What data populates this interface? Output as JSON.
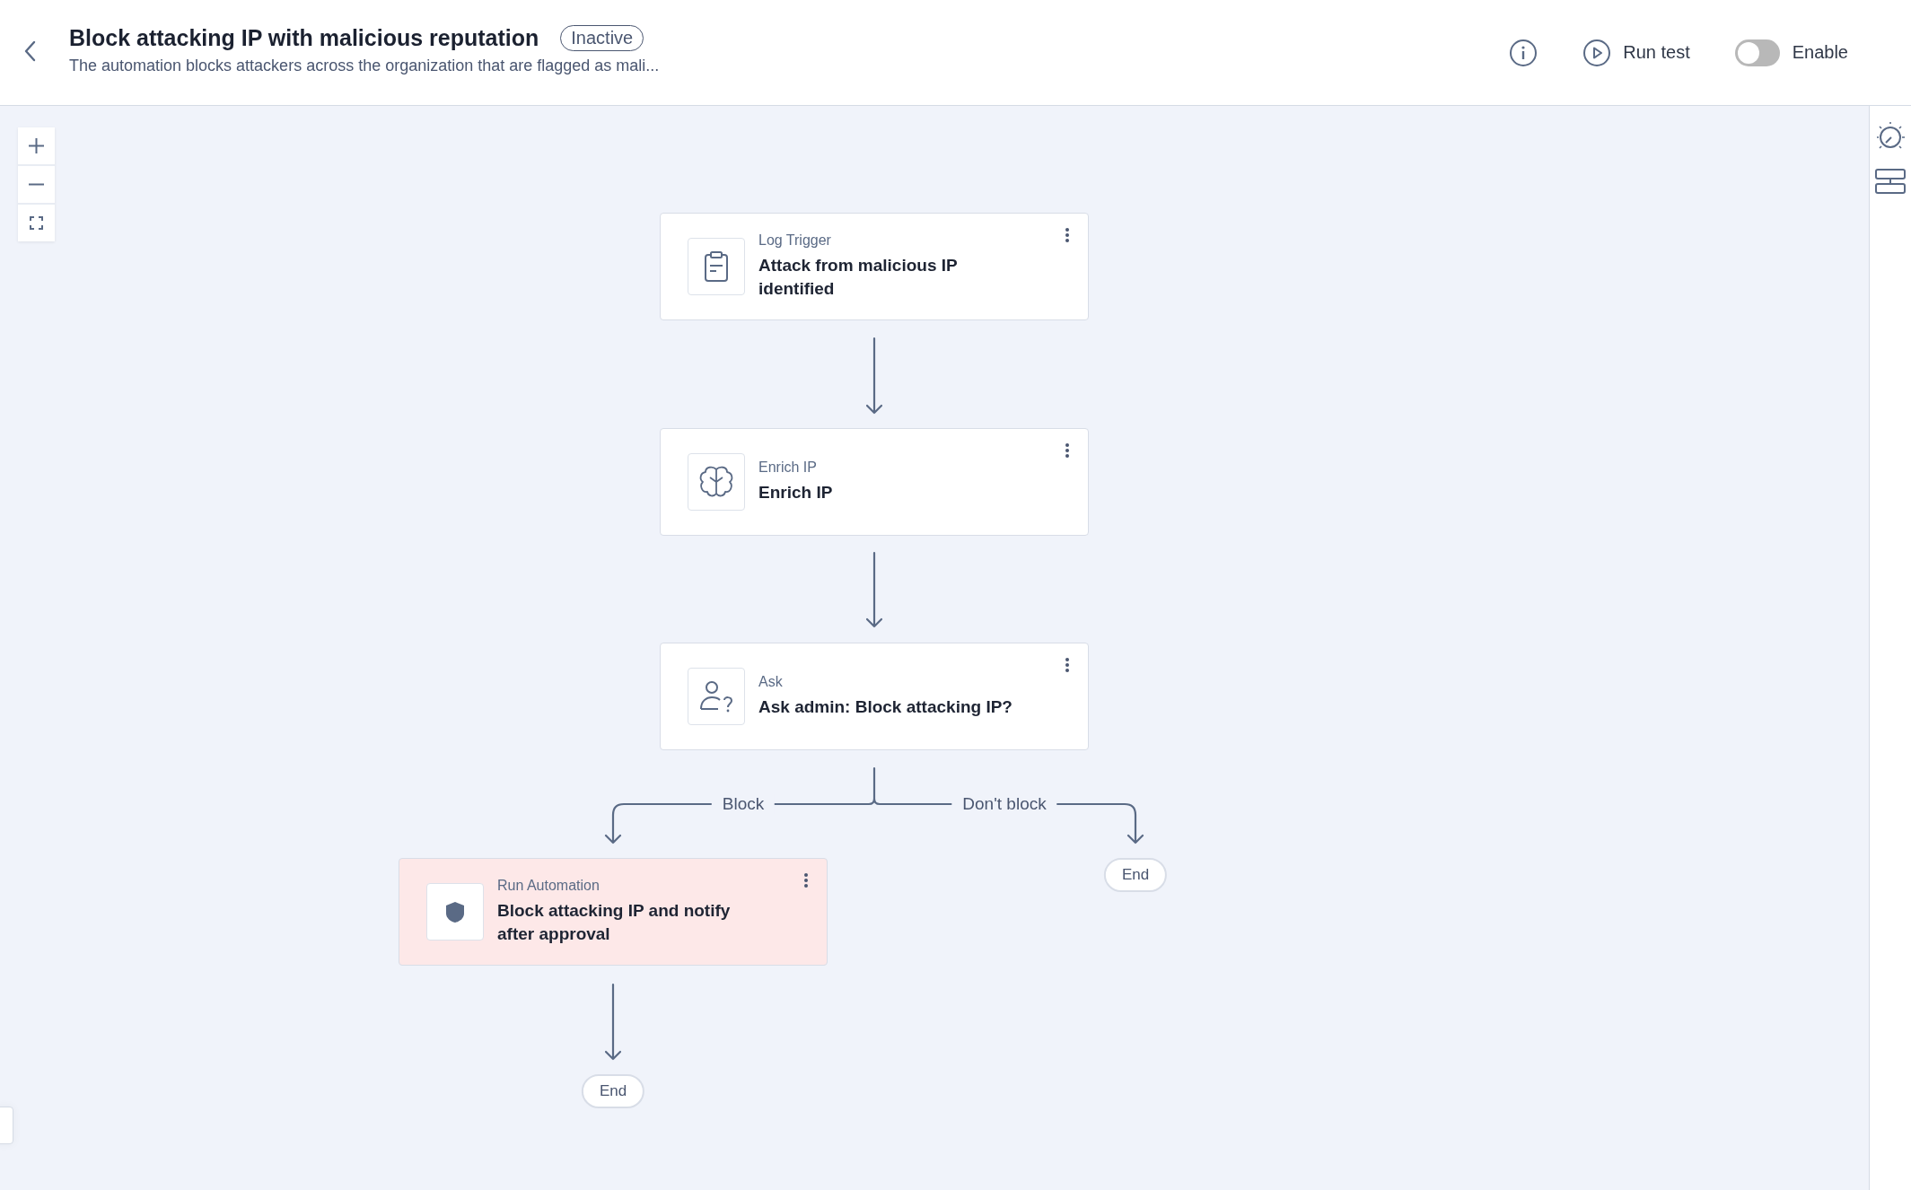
{
  "header": {
    "title": "Block attacking IP with malicious reputation",
    "status": "Inactive",
    "description": "The automation blocks attackers across the organization that are flagged as mali...",
    "run_test": "Run test",
    "toggle": {
      "label": "Enable",
      "on": false
    }
  },
  "flow": {
    "nodes": [
      {
        "kind": "log",
        "type_label": "Log Trigger",
        "title": "Attack from malicious IP identified",
        "highlighted": false
      },
      {
        "kind": "enrich",
        "type_label": "Enrich IP",
        "title": "Enrich IP",
        "highlighted": false
      },
      {
        "kind": "ask",
        "type_label": "Ask",
        "title": "Ask admin: Block attacking IP?",
        "highlighted": false
      },
      {
        "kind": "automation",
        "type_label": "Run Automation",
        "title": "Block attacking IP and notify after approval",
        "highlighted": true
      }
    ],
    "branches": [
      {
        "label": "Block"
      },
      {
        "label": "Don't block"
      }
    ],
    "ends": [
      "End",
      "End"
    ]
  }
}
